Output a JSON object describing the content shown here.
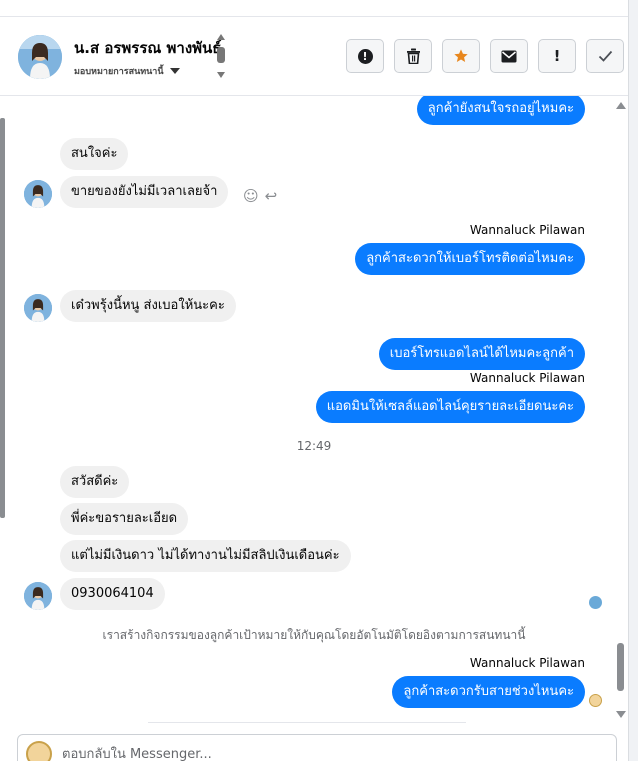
{
  "header": {
    "contact_name": "น.ส อรพรรณ พางพันธ์",
    "subtitle": "มอบหมายการสนทนานี้",
    "actions": [
      {
        "icon": "alert-circle-icon"
      },
      {
        "icon": "trash-icon"
      },
      {
        "icon": "star-icon"
      },
      {
        "icon": "envelope-icon"
      },
      {
        "icon": "exclamation-icon"
      },
      {
        "icon": "checkmark-icon"
      }
    ]
  },
  "messages": [
    {
      "direction": "out",
      "text": "ลูกค้ายังสนใจรถอยู่ไหมคะ"
    },
    {
      "direction": "in",
      "text": "สนใจค่ะ"
    },
    {
      "direction": "in",
      "text": "ขายของยังไม่มีเวลาเลยจ้า"
    },
    {
      "direction": "out",
      "sender": "Wannaluck Pilawan",
      "text": "ลูกค้าสะดวกให้เบอร์โทรติดต่อไหมคะ"
    },
    {
      "direction": "in",
      "text": "เด๋วพรุ้งนี้หนู ส่งเบอให้นะคะ"
    },
    {
      "direction": "out",
      "text": "เบอร์โทรแอดไลน์ได้ไหมคะลูกค้า"
    },
    {
      "direction": "out",
      "sender": "Wannaluck Pilawan",
      "text": "แอดมินให้เซลล์แอดไลน์คุยรายละเอียดนะคะ"
    },
    {
      "type": "timestamp",
      "text": "12:49"
    },
    {
      "direction": "in",
      "text": "สวัสดีค่ะ"
    },
    {
      "direction": "in",
      "text": "พี่ค่ะขอรายละเอียด"
    },
    {
      "direction": "in",
      "text": "แต่ไม่มีเงินดาว ไม่ได้ทางานไม่มีสลิปเงินเดือนค่ะ"
    },
    {
      "direction": "in",
      "text": "0930064104"
    },
    {
      "type": "notice",
      "text": "เราสร้างกิจกรรมของลูกค้าเป้าหมายให้กับคุณโดยอัตโนมัติโดยอิงตามการสนทนานี้"
    },
    {
      "direction": "out",
      "sender": "Wannaluck Pilawan",
      "text": "ลูกค้าสะดวกรับสายช่วงไหนคะ"
    }
  ],
  "composer": {
    "placeholder": "ตอบกลับใน Messenger..."
  },
  "colors": {
    "outgoing_bubble": "#0a7cff",
    "incoming_bubble": "#f0f0f0",
    "star_accent": "#e8871e"
  }
}
